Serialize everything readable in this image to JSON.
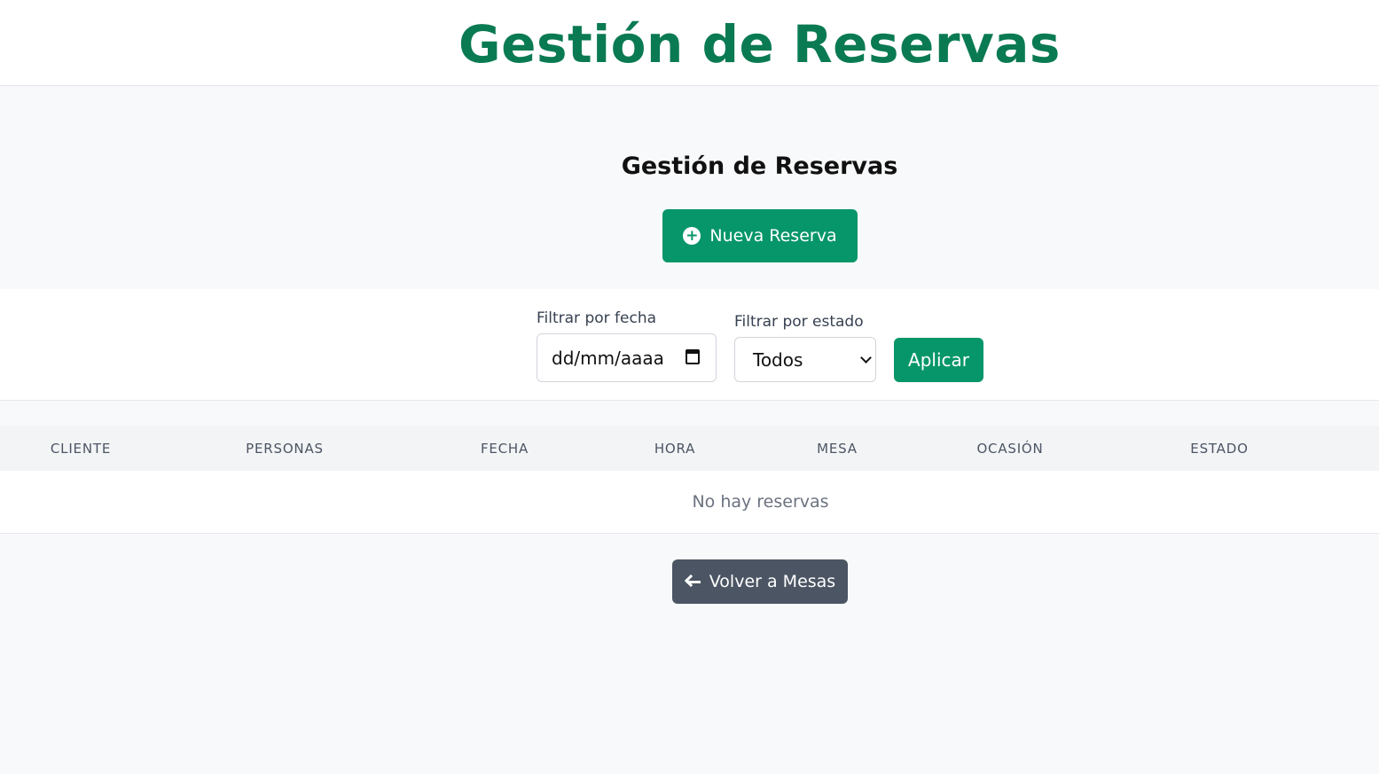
{
  "header": {
    "title": "Gestión de Reservas"
  },
  "main": {
    "title": "Gestión de Reservas",
    "new_button": {
      "icon": "plus-circle-icon",
      "label": "Nueva Reserva"
    }
  },
  "filters": {
    "date_label": "Filtrar por fecha",
    "date_placeholder": "dd/mm/aaaa",
    "status_label": "Filtrar por estado",
    "status_value": "Todos",
    "apply_label": "Aplicar"
  },
  "table": {
    "columns": [
      "CLIENTE",
      "PERSONAS",
      "FECHA",
      "HORA",
      "MESA",
      "OCASIÓN",
      "ESTADO"
    ],
    "empty_text": "No hay reservas"
  },
  "footer": {
    "back_button": {
      "icon": "arrow-left-icon",
      "label": "Volver a Mesas"
    }
  },
  "colors": {
    "accent": "#079669",
    "title": "#0a7a52",
    "secondary_button": "#4b5563"
  }
}
